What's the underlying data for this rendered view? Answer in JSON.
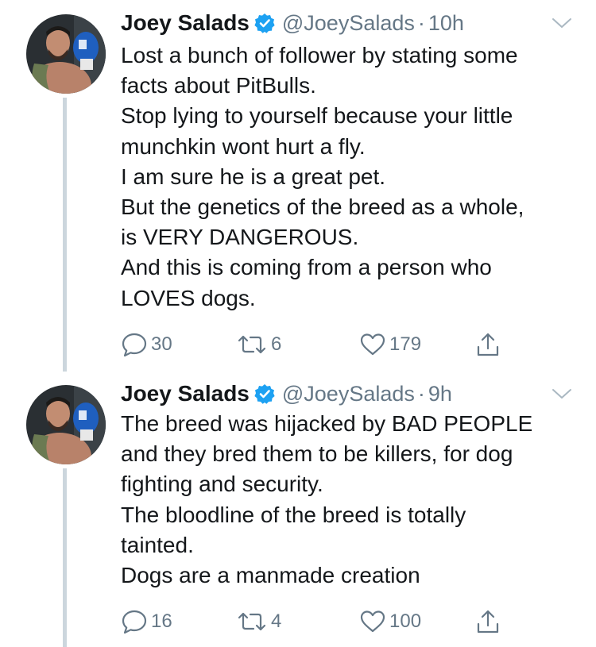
{
  "tweets": [
    {
      "name": "Joey Salads",
      "handle": "@JoeySalads",
      "separator": "·",
      "time": "10h",
      "lines": [
        "Lost a bunch of follower by stating some",
        "facts about PitBulls.",
        "Stop lying to yourself because your little",
        "munchkin wont hurt a fly.",
        "I am sure he is a great pet.",
        "But the genetics of the breed as a whole,",
        "is VERY DANGEROUS.",
        "And this is coming from a person who",
        "LOVES dogs."
      ],
      "replies": "30",
      "retweets": "6",
      "likes": "179"
    },
    {
      "name": "Joey Salads",
      "handle": "@JoeySalads",
      "separator": "·",
      "time": "9h",
      "lines": [
        "The breed was hijacked by BAD PEOPLE",
        "and they bred them to be killers, for dog",
        "fighting and security.",
        "The bloodline of the breed is totally",
        "tainted.",
        "Dogs are a manmade creation"
      ],
      "replies": "16",
      "retweets": "4",
      "likes": "100"
    }
  ],
  "icons": {
    "verified": "verified-badge-icon",
    "caret": "chevron-down-icon",
    "reply": "reply-icon",
    "retweet": "retweet-icon",
    "like": "heart-icon",
    "share": "share-icon"
  },
  "colors": {
    "text": "#14171a",
    "secondary": "#657786",
    "verified": "#1da1f2",
    "thread_line": "#ccd6dd"
  }
}
